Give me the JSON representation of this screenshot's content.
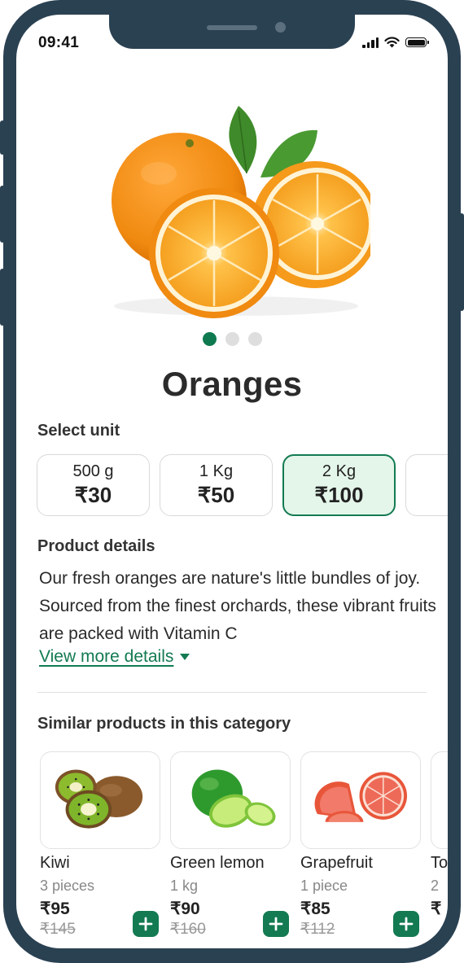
{
  "status": {
    "time": "09:41"
  },
  "product": {
    "name": "Oranges",
    "image": "oranges-image",
    "carousel": {
      "count": 3,
      "active": 0
    }
  },
  "units": {
    "label": "Select unit",
    "selected_index": 2,
    "options": [
      {
        "name": "500 g",
        "price": "₹30"
      },
      {
        "name": "1 Kg",
        "price": "₹50"
      },
      {
        "name": "2 Kg",
        "price": "₹100"
      },
      {
        "name": "",
        "price": ""
      }
    ]
  },
  "details": {
    "label": "Product details",
    "text": "Our fresh oranges are nature's little bundles of joy. Sourced from the finest orchards, these vibrant fruits are packed with Vitamin C",
    "view_more": "View more details"
  },
  "similar": {
    "label": "Similar products in this category",
    "items": [
      {
        "name": "Kiwi",
        "qty": "3 pieces",
        "price": "₹95",
        "old_price": "₹145"
      },
      {
        "name": "Green lemon",
        "qty": "1 kg",
        "price": "₹90",
        "old_price": "₹160"
      },
      {
        "name": "Grapefruit",
        "qty": "1 piece",
        "price": "₹85",
        "old_price": "₹112"
      },
      {
        "name": "To",
        "qty": "2",
        "price": "₹",
        "old_price": ""
      }
    ]
  },
  "colors": {
    "accent": "#137a52",
    "selected_bg": "#e4f6ea",
    "frame": "#2a4152"
  }
}
